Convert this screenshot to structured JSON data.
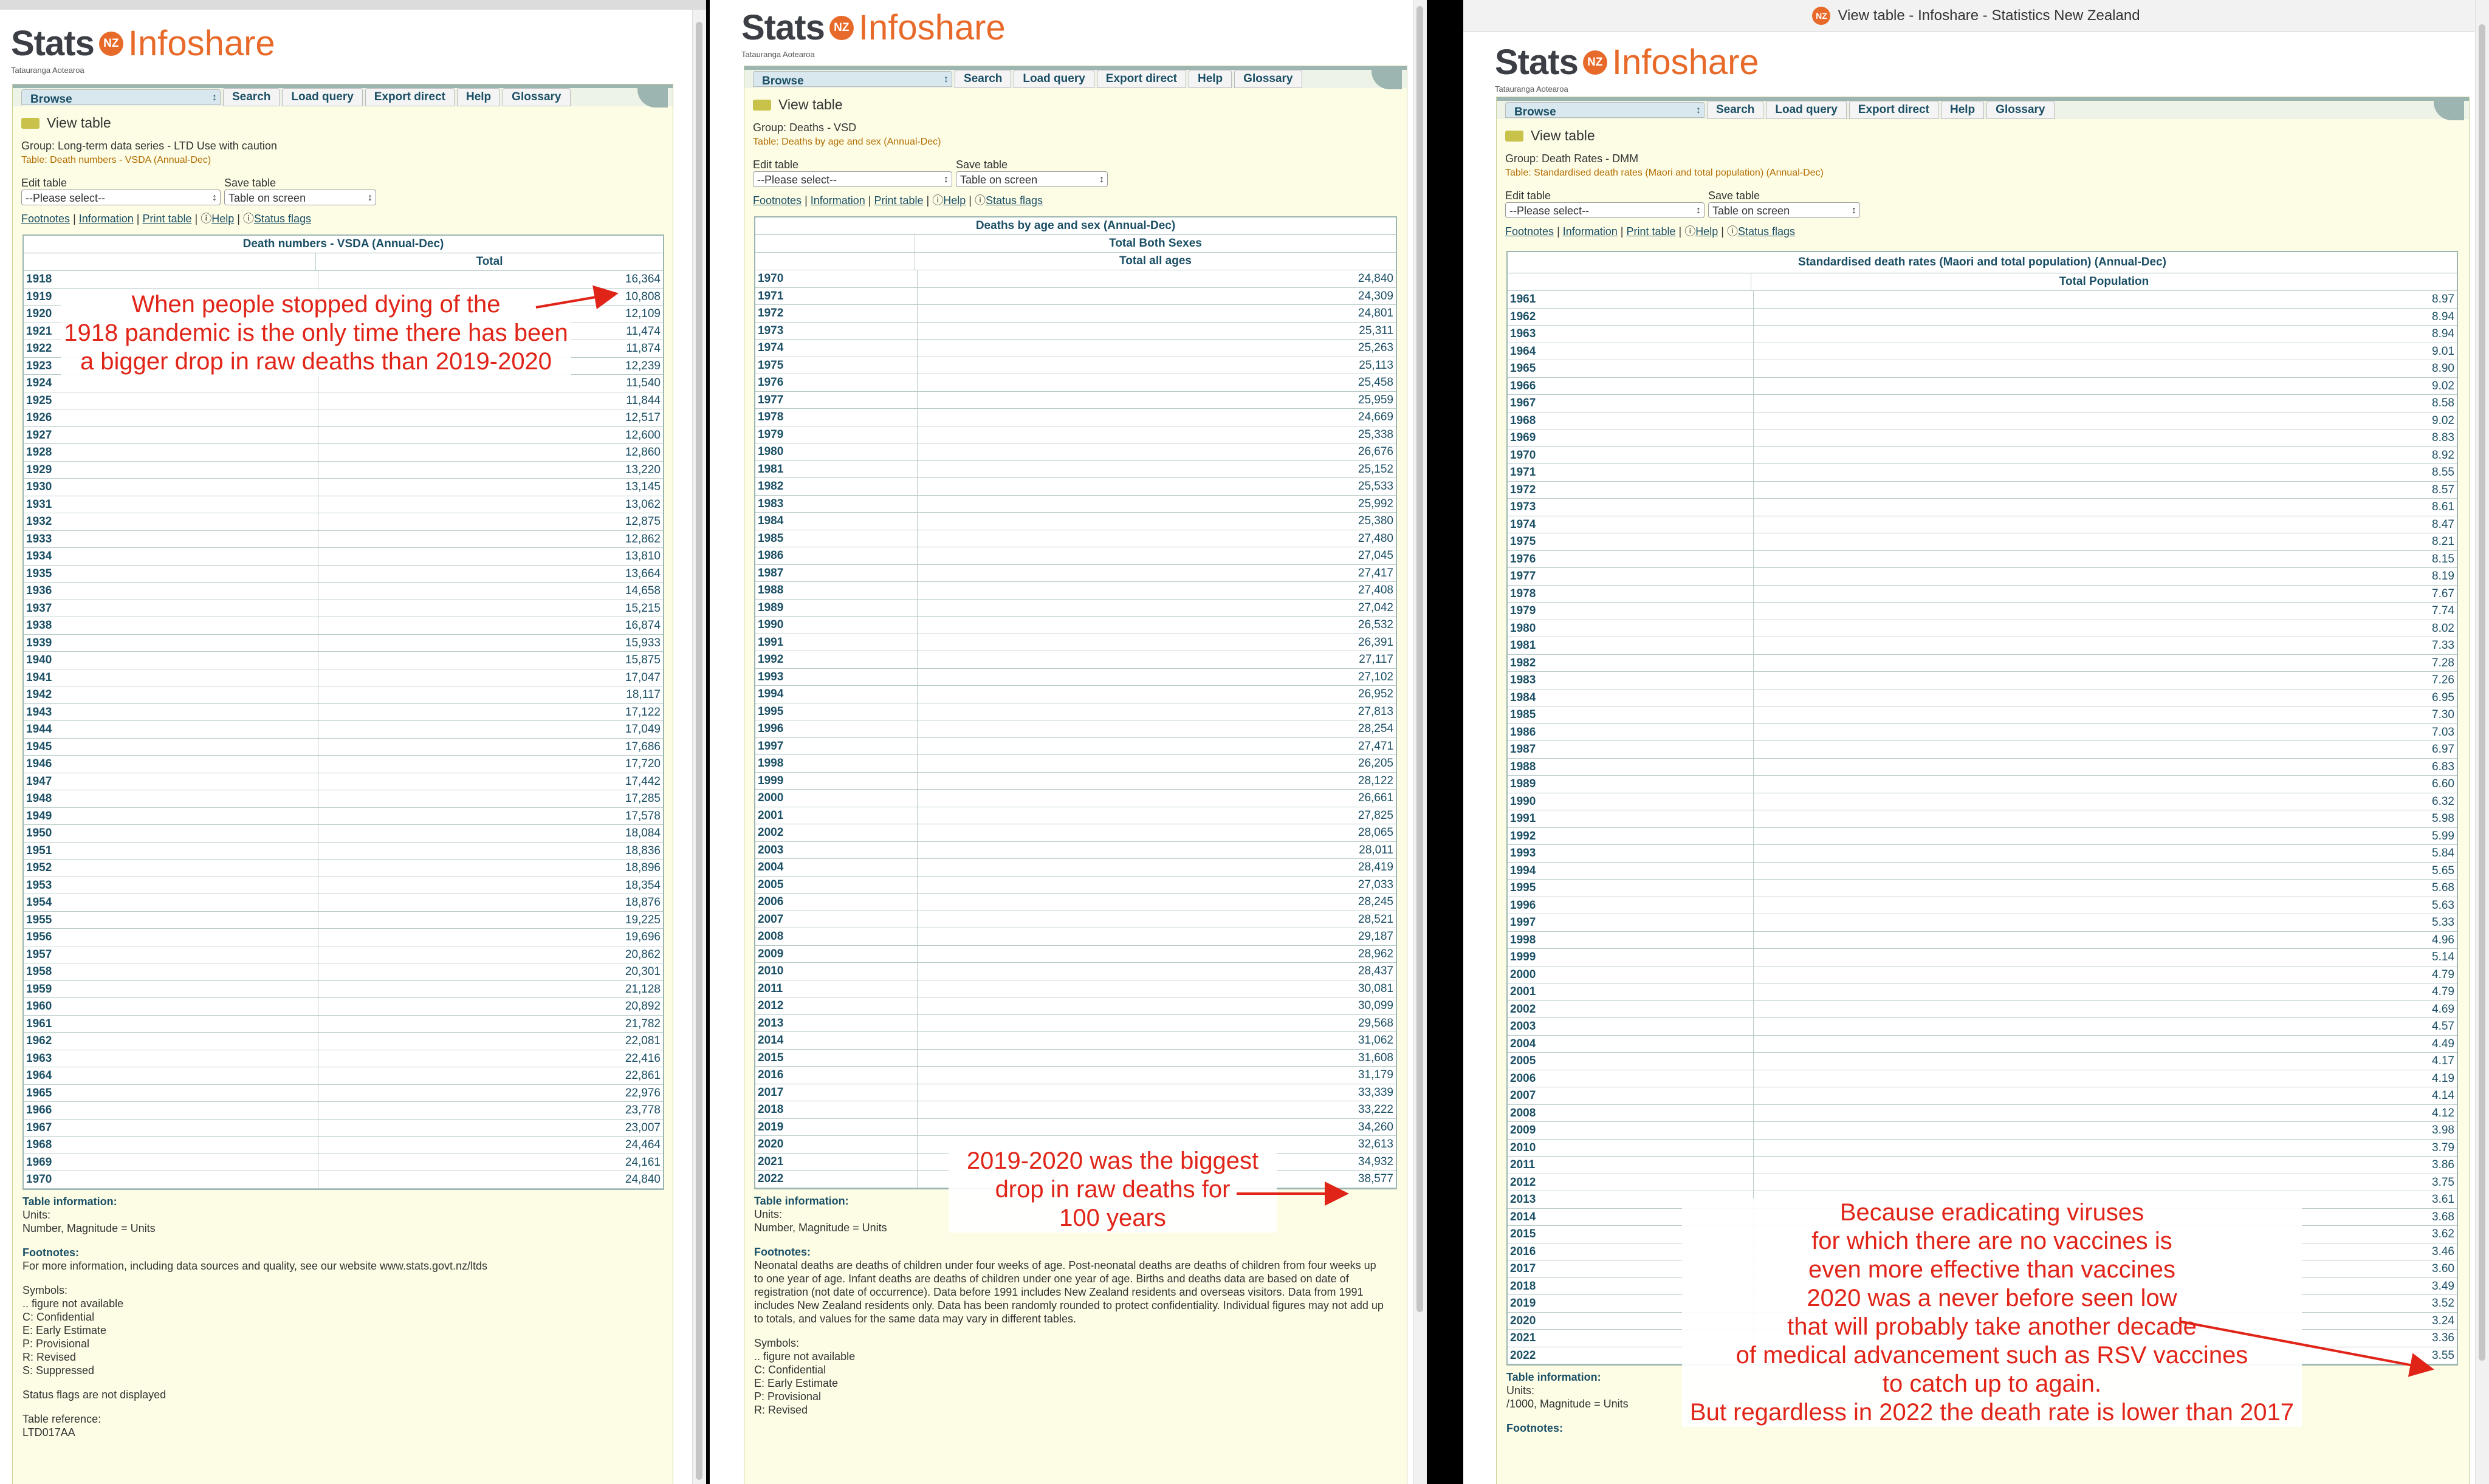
{
  "brand": {
    "stats": "Stats",
    "nz": "NZ",
    "infoshare": "Infoshare",
    "subtitle": "Tatauranga Aotearoa"
  },
  "window_title": "View table - Infoshare - Statistics New Zealand",
  "nav": {
    "browse": "Browse",
    "search": "Search",
    "load_query": "Load query",
    "export_direct": "Export direct",
    "help": "Help",
    "glossary": "Glossary"
  },
  "view_table": "View table",
  "controls": {
    "edit_label": "Edit table",
    "save_label": "Save table",
    "edit_value": "--Please select--",
    "save_value": "Table on screen"
  },
  "links": {
    "footnotes": "Footnotes",
    "information": "Information",
    "print_table": "Print table",
    "help": "Help",
    "status_flags": "Status flags"
  },
  "panel1": {
    "group": "Group: Long-term data series - LTD Use with caution",
    "table_ref": "Table: Death numbers - VSDA (Annual-Dec)",
    "table_title": "Death numbers - VSDA (Annual-Dec)",
    "col_header": "Total",
    "rows": [
      {
        "y": "1918",
        "v": "16,364"
      },
      {
        "y": "1919",
        "v": "10,808"
      },
      {
        "y": "1920",
        "v": "12,109"
      },
      {
        "y": "1921",
        "v": "11,474"
      },
      {
        "y": "1922",
        "v": "11,874"
      },
      {
        "y": "1923",
        "v": "12,239"
      },
      {
        "y": "1924",
        "v": "11,540"
      },
      {
        "y": "1925",
        "v": "11,844"
      },
      {
        "y": "1926",
        "v": "12,517"
      },
      {
        "y": "1927",
        "v": "12,600"
      },
      {
        "y": "1928",
        "v": "12,860"
      },
      {
        "y": "1929",
        "v": "13,220"
      },
      {
        "y": "1930",
        "v": "13,145"
      },
      {
        "y": "1931",
        "v": "13,062"
      },
      {
        "y": "1932",
        "v": "12,875"
      },
      {
        "y": "1933",
        "v": "12,862"
      },
      {
        "y": "1934",
        "v": "13,810"
      },
      {
        "y": "1935",
        "v": "13,664"
      },
      {
        "y": "1936",
        "v": "14,658"
      },
      {
        "y": "1937",
        "v": "15,215"
      },
      {
        "y": "1938",
        "v": "16,874"
      },
      {
        "y": "1939",
        "v": "15,933"
      },
      {
        "y": "1940",
        "v": "15,875"
      },
      {
        "y": "1941",
        "v": "17,047"
      },
      {
        "y": "1942",
        "v": "18,117"
      },
      {
        "y": "1943",
        "v": "17,122"
      },
      {
        "y": "1944",
        "v": "17,049"
      },
      {
        "y": "1945",
        "v": "17,686"
      },
      {
        "y": "1946",
        "v": "17,720"
      },
      {
        "y": "1947",
        "v": "17,442"
      },
      {
        "y": "1948",
        "v": "17,285"
      },
      {
        "y": "1949",
        "v": "17,578"
      },
      {
        "y": "1950",
        "v": "18,084"
      },
      {
        "y": "1951",
        "v": "18,836"
      },
      {
        "y": "1952",
        "v": "18,896"
      },
      {
        "y": "1953",
        "v": "18,354"
      },
      {
        "y": "1954",
        "v": "18,876"
      },
      {
        "y": "1955",
        "v": "19,225"
      },
      {
        "y": "1956",
        "v": "19,696"
      },
      {
        "y": "1957",
        "v": "20,862"
      },
      {
        "y": "1958",
        "v": "20,301"
      },
      {
        "y": "1959",
        "v": "21,128"
      },
      {
        "y": "1960",
        "v": "20,892"
      },
      {
        "y": "1961",
        "v": "21,782"
      },
      {
        "y": "1962",
        "v": "22,081"
      },
      {
        "y": "1963",
        "v": "22,416"
      },
      {
        "y": "1964",
        "v": "22,861"
      },
      {
        "y": "1965",
        "v": "22,976"
      },
      {
        "y": "1966",
        "v": "23,778"
      },
      {
        "y": "1967",
        "v": "23,007"
      },
      {
        "y": "1968",
        "v": "24,464"
      },
      {
        "y": "1969",
        "v": "24,161"
      },
      {
        "y": "1970",
        "v": "24,840"
      }
    ],
    "info_title": "Table information:",
    "units_label": "Units:",
    "units": "Number, Magnitude = Units",
    "footnotes_title": "Footnotes:",
    "footnote_text": "For more information, including data sources and quality, see our website www.stats.govt.nz/ltds",
    "symbols": [
      "Symbols:",
      ".. figure not available",
      "C: Confidential",
      "E: Early Estimate",
      "P: Provisional",
      "R: Revised",
      "S: Suppressed"
    ],
    "status_flags_note": "Status flags are not displayed",
    "table_reference_label": "Table reference:",
    "table_reference": "LTD017AA",
    "annotation": "When people stopped dying of the\n1918 pandemic is the only time there has been\na bigger drop in raw deaths than 2019-2020"
  },
  "panel2": {
    "group": "Group: Deaths - VSD",
    "table_ref": "Table: Deaths by age and sex (Annual-Dec)",
    "table_title": "Deaths by age and sex (Annual-Dec)",
    "col_header1": "Total Both Sexes",
    "col_header2": "Total all ages",
    "rows": [
      {
        "y": "1970",
        "v": "24,840"
      },
      {
        "y": "1971",
        "v": "24,309"
      },
      {
        "y": "1972",
        "v": "24,801"
      },
      {
        "y": "1973",
        "v": "25,311"
      },
      {
        "y": "1974",
        "v": "25,263"
      },
      {
        "y": "1975",
        "v": "25,113"
      },
      {
        "y": "1976",
        "v": "25,458"
      },
      {
        "y": "1977",
        "v": "25,959"
      },
      {
        "y": "1978",
        "v": "24,669"
      },
      {
        "y": "1979",
        "v": "25,338"
      },
      {
        "y": "1980",
        "v": "26,676"
      },
      {
        "y": "1981",
        "v": "25,152"
      },
      {
        "y": "1982",
        "v": "25,533"
      },
      {
        "y": "1983",
        "v": "25,992"
      },
      {
        "y": "1984",
        "v": "25,380"
      },
      {
        "y": "1985",
        "v": "27,480"
      },
      {
        "y": "1986",
        "v": "27,045"
      },
      {
        "y": "1987",
        "v": "27,417"
      },
      {
        "y": "1988",
        "v": "27,408"
      },
      {
        "y": "1989",
        "v": "27,042"
      },
      {
        "y": "1990",
        "v": "26,532"
      },
      {
        "y": "1991",
        "v": "26,391"
      },
      {
        "y": "1992",
        "v": "27,117"
      },
      {
        "y": "1993",
        "v": "27,102"
      },
      {
        "y": "1994",
        "v": "26,952"
      },
      {
        "y": "1995",
        "v": "27,813"
      },
      {
        "y": "1996",
        "v": "28,254"
      },
      {
        "y": "1997",
        "v": "27,471"
      },
      {
        "y": "1998",
        "v": "26,205"
      },
      {
        "y": "1999",
        "v": "28,122"
      },
      {
        "y": "2000",
        "v": "26,661"
      },
      {
        "y": "2001",
        "v": "27,825"
      },
      {
        "y": "2002",
        "v": "28,065"
      },
      {
        "y": "2003",
        "v": "28,011"
      },
      {
        "y": "2004",
        "v": "28,419"
      },
      {
        "y": "2005",
        "v": "27,033"
      },
      {
        "y": "2006",
        "v": "28,245"
      },
      {
        "y": "2007",
        "v": "28,521"
      },
      {
        "y": "2008",
        "v": "29,187"
      },
      {
        "y": "2009",
        "v": "28,962"
      },
      {
        "y": "2010",
        "v": "28,437"
      },
      {
        "y": "2011",
        "v": "30,081"
      },
      {
        "y": "2012",
        "v": "30,099"
      },
      {
        "y": "2013",
        "v": "29,568"
      },
      {
        "y": "2014",
        "v": "31,062"
      },
      {
        "y": "2015",
        "v": "31,608"
      },
      {
        "y": "2016",
        "v": "31,179"
      },
      {
        "y": "2017",
        "v": "33,339"
      },
      {
        "y": "2018",
        "v": "33,222"
      },
      {
        "y": "2019",
        "v": "34,260"
      },
      {
        "y": "2020",
        "v": "32,613"
      },
      {
        "y": "2021",
        "v": "34,932"
      },
      {
        "y": "2022",
        "v": "38,577"
      }
    ],
    "info_title": "Table information:",
    "units_label": "Units:",
    "units": "Number, Magnitude = Units",
    "footnotes_title": "Footnotes:",
    "footnote_text": "Neonatal deaths are deaths of children under four weeks of age. Post-neonatal deaths are deaths of children from four weeks up to one year of age. Infant deaths are deaths of children under one year of age. Births and deaths data are based on date of registration (not date of occurrence). Data before 1991 includes New Zealand residents and overseas visitors. Data from 1991 includes New Zealand residents only. Data has been randomly rounded to protect confidentiality. Individual figures may not add up to totals, and values for the same data may vary in different tables.",
    "symbols": [
      "Symbols:",
      ".. figure not available",
      "C: Confidential",
      "E: Early Estimate",
      "P: Provisional",
      "R: Revised"
    ],
    "annotation": "2019-2020 was the biggest\ndrop in raw deaths for\n100 years"
  },
  "panel3": {
    "group": "Group: Death Rates - DMM",
    "table_ref": "Table: Standardised death rates (Maori and total population) (Annual-Dec)",
    "table_title": "Standardised death rates (Maori and total population) (Annual-Dec)",
    "col_header": "Total Population",
    "rows": [
      {
        "y": "1961",
        "v": "8.97"
      },
      {
        "y": "1962",
        "v": "8.94"
      },
      {
        "y": "1963",
        "v": "8.94"
      },
      {
        "y": "1964",
        "v": "9.01"
      },
      {
        "y": "1965",
        "v": "8.90"
      },
      {
        "y": "1966",
        "v": "9.02"
      },
      {
        "y": "1967",
        "v": "8.58"
      },
      {
        "y": "1968",
        "v": "9.02"
      },
      {
        "y": "1969",
        "v": "8.83"
      },
      {
        "y": "1970",
        "v": "8.92"
      },
      {
        "y": "1971",
        "v": "8.55"
      },
      {
        "y": "1972",
        "v": "8.57"
      },
      {
        "y": "1973",
        "v": "8.61"
      },
      {
        "y": "1974",
        "v": "8.47"
      },
      {
        "y": "1975",
        "v": "8.21"
      },
      {
        "y": "1976",
        "v": "8.15"
      },
      {
        "y": "1977",
        "v": "8.19"
      },
      {
        "y": "1978",
        "v": "7.67"
      },
      {
        "y": "1979",
        "v": "7.74"
      },
      {
        "y": "1980",
        "v": "8.02"
      },
      {
        "y": "1981",
        "v": "7.33"
      },
      {
        "y": "1982",
        "v": "7.28"
      },
      {
        "y": "1983",
        "v": "7.26"
      },
      {
        "y": "1984",
        "v": "6.95"
      },
      {
        "y": "1985",
        "v": "7.30"
      },
      {
        "y": "1986",
        "v": "7.03"
      },
      {
        "y": "1987",
        "v": "6.97"
      },
      {
        "y": "1988",
        "v": "6.83"
      },
      {
        "y": "1989",
        "v": "6.60"
      },
      {
        "y": "1990",
        "v": "6.32"
      },
      {
        "y": "1991",
        "v": "5.98"
      },
      {
        "y": "1992",
        "v": "5.99"
      },
      {
        "y": "1993",
        "v": "5.84"
      },
      {
        "y": "1994",
        "v": "5.65"
      },
      {
        "y": "1995",
        "v": "5.68"
      },
      {
        "y": "1996",
        "v": "5.63"
      },
      {
        "y": "1997",
        "v": "5.33"
      },
      {
        "y": "1998",
        "v": "4.96"
      },
      {
        "y": "1999",
        "v": "5.14"
      },
      {
        "y": "2000",
        "v": "4.79"
      },
      {
        "y": "2001",
        "v": "4.79"
      },
      {
        "y": "2002",
        "v": "4.69"
      },
      {
        "y": "2003",
        "v": "4.57"
      },
      {
        "y": "2004",
        "v": "4.49"
      },
      {
        "y": "2005",
        "v": "4.17"
      },
      {
        "y": "2006",
        "v": "4.19"
      },
      {
        "y": "2007",
        "v": "4.14"
      },
      {
        "y": "2008",
        "v": "4.12"
      },
      {
        "y": "2009",
        "v": "3.98"
      },
      {
        "y": "2010",
        "v": "3.79"
      },
      {
        "y": "2011",
        "v": "3.86"
      },
      {
        "y": "2012",
        "v": "3.75"
      },
      {
        "y": "2013",
        "v": "3.61"
      },
      {
        "y": "2014",
        "v": "3.68"
      },
      {
        "y": "2015",
        "v": "3.62"
      },
      {
        "y": "2016",
        "v": "3.46"
      },
      {
        "y": "2017",
        "v": "3.60"
      },
      {
        "y": "2018",
        "v": "3.49"
      },
      {
        "y": "2019",
        "v": "3.52"
      },
      {
        "y": "2020",
        "v": "3.24"
      },
      {
        "y": "2021",
        "v": "3.36"
      },
      {
        "y": "2022",
        "v": "3.55"
      }
    ],
    "info_title": "Table information:",
    "units_label": "Units:",
    "units": "/1000, Magnitude = Units",
    "footnotes_title": "Footnotes:",
    "annotation": "Because eradicating viruses\nfor which there are no vaccines is\neven more effective than vaccines\n2020 was a never before seen low\nthat will probably take another decade\nof medical advancement such as RSV vaccines\nto catch up to again.\nBut regardless in 2022 the death rate is lower than 2017"
  }
}
